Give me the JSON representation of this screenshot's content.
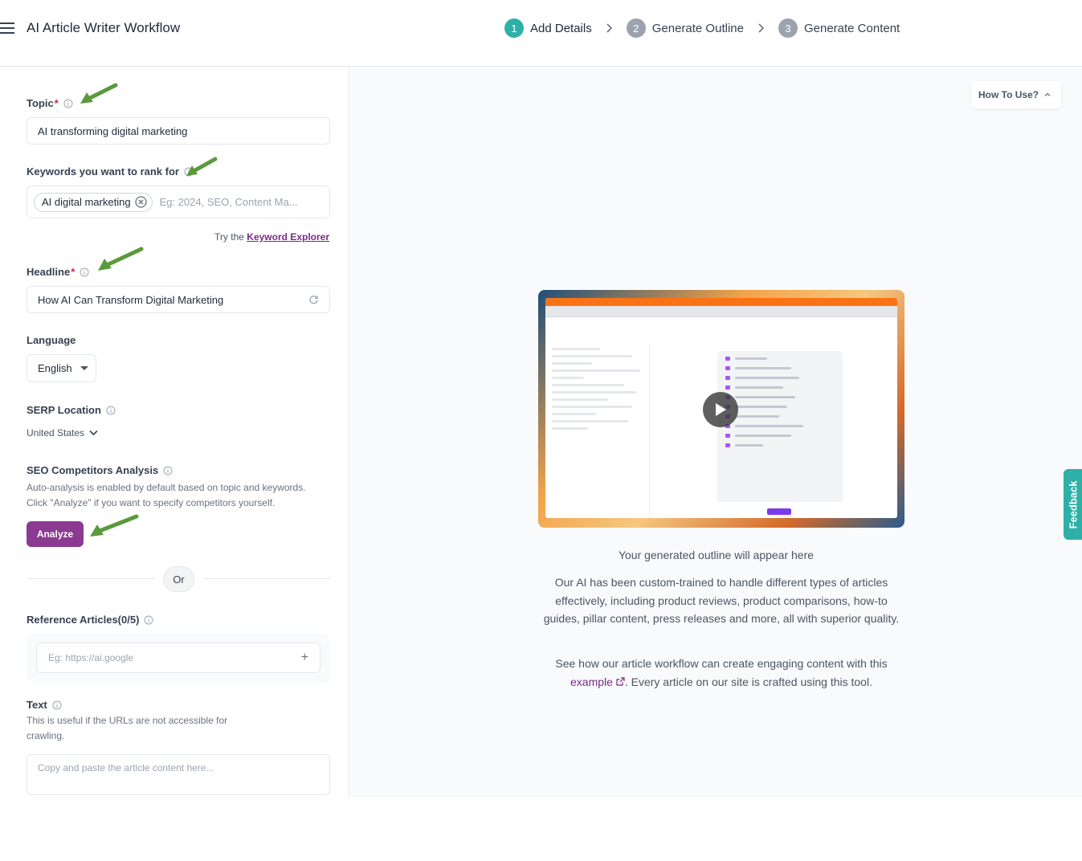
{
  "header": {
    "title": "AI Article Writer Workflow",
    "steps": [
      {
        "num": "1",
        "label": "Add Details"
      },
      {
        "num": "2",
        "label": "Generate Outline"
      },
      {
        "num": "3",
        "label": "Generate Content"
      }
    ]
  },
  "form": {
    "topic": {
      "label": "Topic",
      "required": "*",
      "value": "AI transforming digital marketing"
    },
    "keywords": {
      "label": "Keywords you want to rank for",
      "chip": "AI digital marketing",
      "placeholder": "Eg: 2024, SEO, Content Ma..."
    },
    "keyword_explorer": {
      "prefix": "Try the",
      "link": "Keyword Explorer"
    },
    "headline": {
      "label": "Headline",
      "required": "*",
      "value": "How AI Can Transform Digital Marketing"
    },
    "language": {
      "label": "Language",
      "value": "English"
    },
    "serp": {
      "label": "SERP Location",
      "value": "United States"
    },
    "competitors": {
      "label": "SEO Competitors Analysis",
      "desc_line1": "Auto-analysis is enabled by default based on topic and keywords.",
      "desc_line2": "Click \"Analyze\" if you want to specify competitors yourself.",
      "button": "Analyze"
    },
    "or": "Or",
    "reference": {
      "label": "Reference Articles(0/5)",
      "placeholder": "Eg: https://ai.google"
    },
    "text": {
      "label": "Text",
      "desc_line1": "This is useful if the URLs are not accessible for",
      "desc_line2": "crawling.",
      "placeholder": "Copy and paste the article content here..."
    }
  },
  "preview": {
    "how_to": "How To Use?",
    "outline_title": "Your generated outline will appear here",
    "para1": "Our AI has been custom-trained to handle different types of articles effectively, including product reviews, product comparisons, how-to guides, pillar content, press releases and more, all with superior quality.",
    "para2_prefix": "See how our article workflow can create engaging content with this",
    "para2_link": "example",
    "para2_suffix": ". Every article on our site is crafted using this tool."
  },
  "feedback": "Feedback",
  "colors": {
    "accent_teal": "#2eb0a8",
    "brand_purple": "#8b3a92",
    "arrow_green": "#5a9a3c"
  }
}
